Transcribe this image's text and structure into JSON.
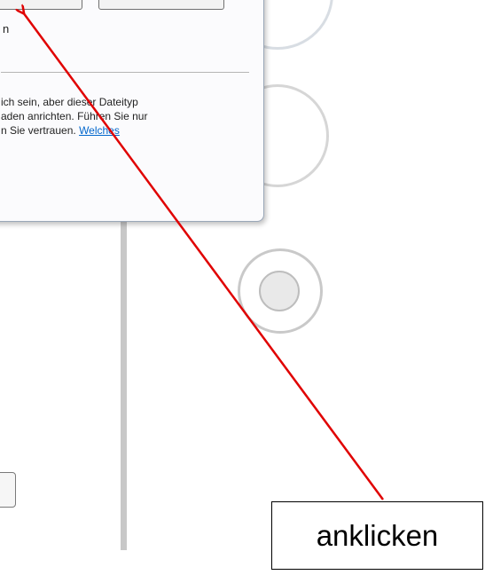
{
  "dialog": {
    "fragment_label": "n",
    "warning_line1": "ich sein, aber dieser Dateityp",
    "warning_line2": "aden anrichten. Führen Sie nur",
    "warning_line3": "n Sie vertrauen.",
    "warning_link": "Welches"
  },
  "annotation": {
    "label": "anklicken",
    "arrow_color": "#e00000"
  }
}
